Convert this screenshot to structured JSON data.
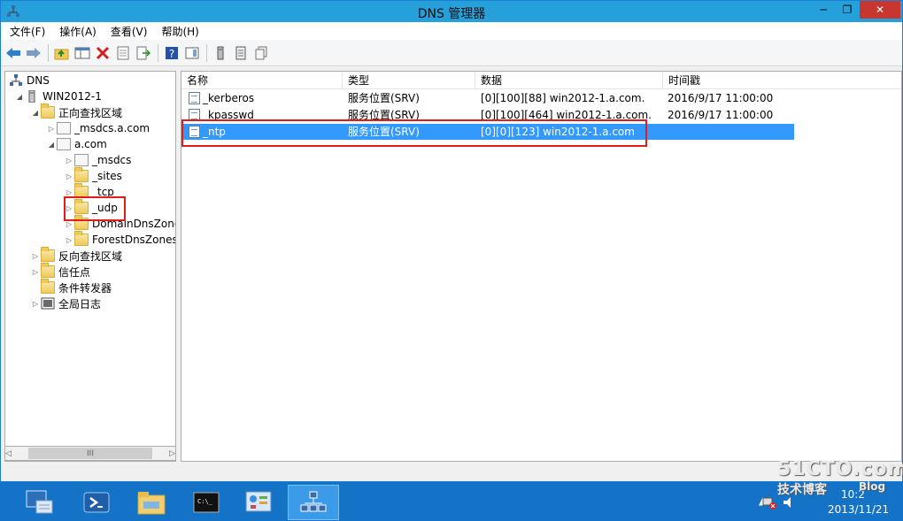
{
  "window": {
    "title": "DNS 管理器"
  },
  "menu": [
    "文件(F)",
    "操作(A)",
    "查看(V)",
    "帮助(H)"
  ],
  "tree": {
    "root": "DNS",
    "server": "WIN2012-1",
    "forward_zones": "正向查找区域",
    "msdcs_zone": "_msdcs.a.com",
    "a_com": "a.com",
    "msdcs": "_msdcs",
    "sites": "_sites",
    "tcp": "_tcp",
    "udp": "_udp",
    "domain_dns": "DomainDnsZones",
    "forest_dns": "ForestDnsZones",
    "reverse_zones": "反向查找区域",
    "trust_points": "信任点",
    "conditional_forwarders": "条件转发器",
    "global_logs": "全局日志"
  },
  "scroll_thumb": "III",
  "list": {
    "columns": [
      "名称",
      "类型",
      "数据",
      "时间戳"
    ],
    "rows": [
      {
        "name": "_kerberos",
        "type": "服务位置(SRV)",
        "data": "[0][100][88] win2012-1.a.com.",
        "timestamp": "2016/9/17 11:00:00"
      },
      {
        "name": "_kpasswd",
        "type": "服务位置(SRV)",
        "data": "[0][100][464] win2012-1.a.com.",
        "timestamp": "2016/9/17 11:00:00"
      },
      {
        "name": "_ntp",
        "type": "服务位置(SRV)",
        "data": "[0][0][123] win2012-1.a.com",
        "timestamp": ""
      }
    ]
  },
  "tray": {
    "time": "10:2",
    "date": "2013/11/21"
  },
  "watermark": {
    "site": "51CTO.com",
    "sub": "技术博客",
    "blog": "Blog"
  },
  "colors": {
    "accent": "#26a0da",
    "selection": "#3399ff",
    "highlight_box": "#e21b1b",
    "taskbar": "#1473c7"
  }
}
